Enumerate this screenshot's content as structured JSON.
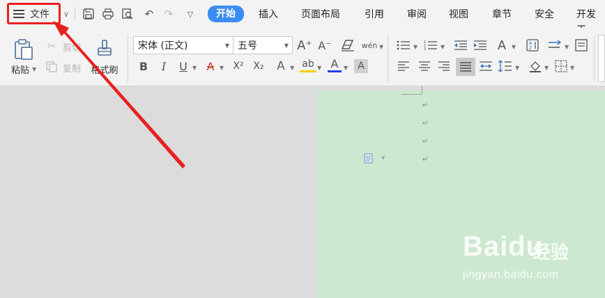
{
  "file_menu": {
    "label": "文件"
  },
  "tabs": [
    {
      "label": "开始",
      "active": true
    },
    {
      "label": "插入"
    },
    {
      "label": "页面布局"
    },
    {
      "label": "引用"
    },
    {
      "label": "审阅"
    },
    {
      "label": "视图"
    },
    {
      "label": "章节"
    },
    {
      "label": "安全"
    },
    {
      "label": "开发工"
    }
  ],
  "ribbon": {
    "paste_label": "粘贴",
    "cut_label": "剪切",
    "copy_label": "复制",
    "format_painter_label": "格式刷",
    "font_name": "宋体 (正文)",
    "font_size": "五号",
    "grow_font": "A⁺",
    "shrink_font": "A⁻",
    "bold": "B",
    "italic": "I",
    "underline": "U",
    "font_color_a": "A",
    "superscript": "X²",
    "subscript": "X₂",
    "text_effect": "A",
    "highlight": "ab",
    "font_color": "A",
    "char_shading": "A",
    "phonetic": "wén"
  },
  "watermark": {
    "logo": "Baidu",
    "brand_cn": "经验",
    "url": "jingyan.baidu.com"
  },
  "colors": {
    "accent": "#3b8cf1",
    "highlight_box": "#e8201f",
    "arrow": "#e8201f",
    "page_bg": "#cce8cf",
    "font_color_underline": "#1a3ee6",
    "highlight_underline": "#f4d000"
  }
}
